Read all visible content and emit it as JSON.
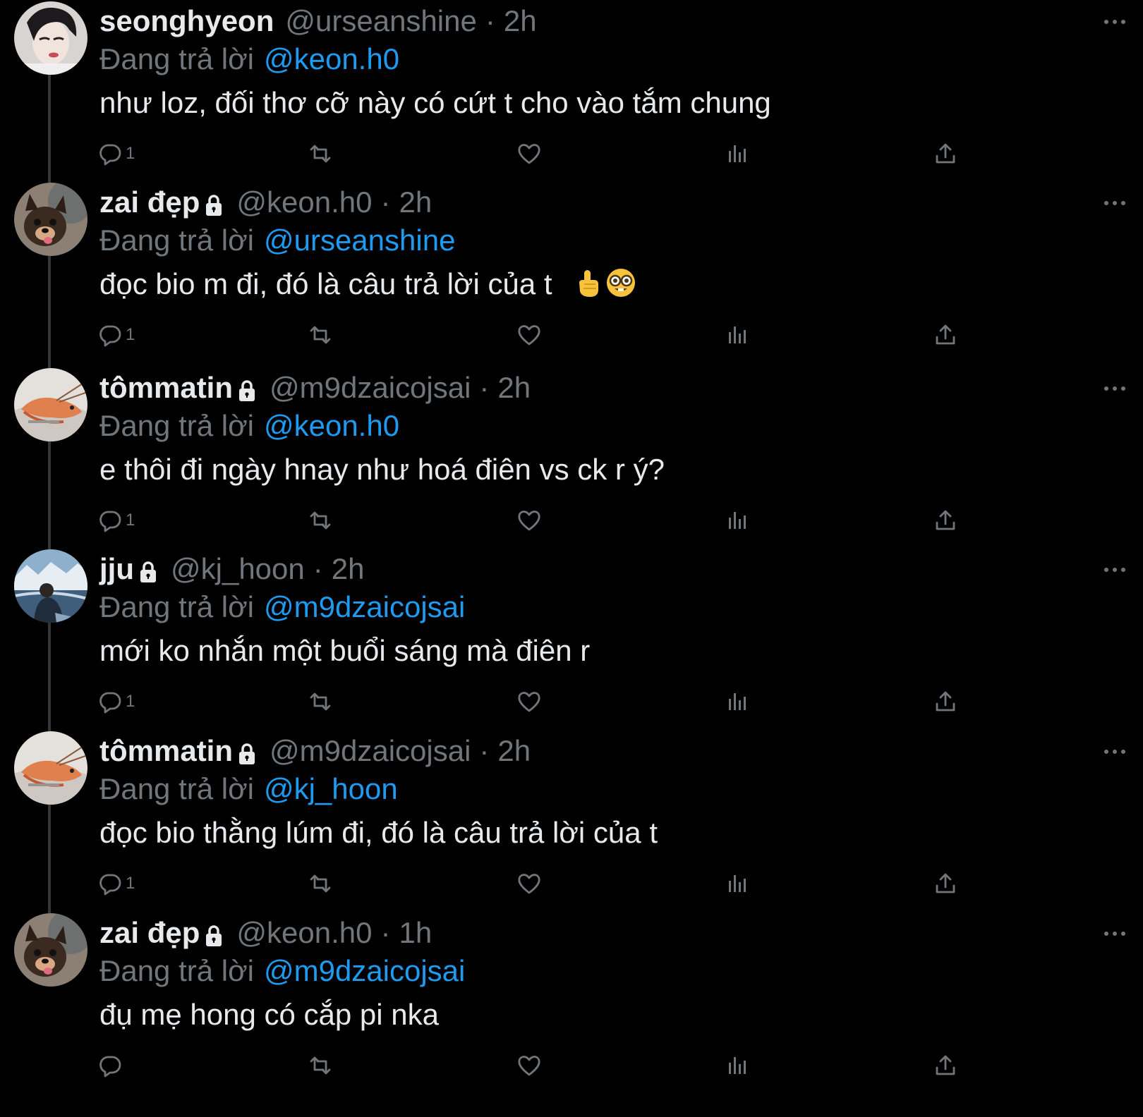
{
  "colors": {
    "background": "#000000",
    "text": "#e7e9ea",
    "secondary": "#71767b",
    "link": "#1d9bf0",
    "thread_line": "#333639"
  },
  "labels": {
    "replying_to": "Đang trả lời",
    "separator": "·"
  },
  "icons": {
    "reply": "reply-icon",
    "retweet": "retweet-icon",
    "like": "like-icon",
    "views": "views-icon",
    "share": "share-icon",
    "more": "more-icon",
    "lock": "lock-icon"
  },
  "tweets": [
    {
      "name": "seonghyeon",
      "locked": false,
      "handle": "@urseanshine",
      "time": "2h",
      "reply_to": "@keon.h0",
      "text": "như loz, đối thơ cỡ này có cứt t cho vào tắm chung",
      "reply_count": "1",
      "avatar": "girl-portrait-avatar"
    },
    {
      "name": "zai đẹp",
      "locked": true,
      "handle": "@keon.h0",
      "time": "2h",
      "reply_to": "@urseanshine",
      "text": "đọc bio m đi, đó là câu trả lời của t",
      "emojis": [
        "index-pointing-up",
        "nerd-face"
      ],
      "reply_count": "1",
      "avatar": "dog-avatar"
    },
    {
      "name": "tômmatin",
      "locked": true,
      "handle": "@m9dzaicojsai",
      "time": "2h",
      "reply_to": "@keon.h0",
      "text": "e thôi đi ngày hnay như hoá điên vs ck r ý?",
      "reply_count": "1",
      "avatar": "shrimp-avatar"
    },
    {
      "name": "jju",
      "locked": true,
      "handle": "@kj_hoon",
      "time": "2h",
      "reply_to": "@m9dzaicojsai",
      "text": "mới ko nhắn một buổi sáng mà điên r",
      "reply_count": "1",
      "avatar": "glacier-avatar"
    },
    {
      "name": "tômmatin",
      "locked": true,
      "handle": "@m9dzaicojsai",
      "time": "2h",
      "reply_to": "@kj_hoon",
      "text": "đọc bio thằng lúm đi, đó là câu trả lời của t",
      "reply_count": "1",
      "avatar": "shrimp-avatar"
    },
    {
      "name": "zai đẹp",
      "locked": true,
      "handle": "@keon.h0",
      "time": "1h",
      "reply_to": "@m9dzaicojsai",
      "text": "đụ mẹ hong có cắp pi nka",
      "reply_count": "",
      "avatar": "dog-avatar"
    }
  ]
}
